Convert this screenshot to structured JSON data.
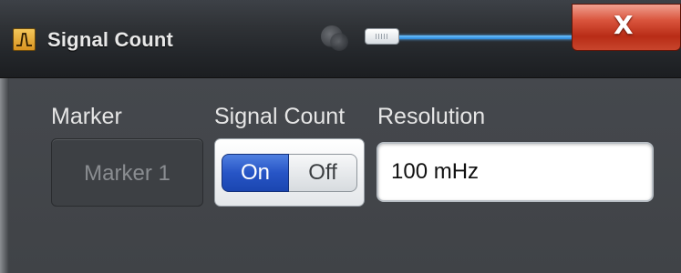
{
  "window": {
    "title": "Signal Count",
    "icon": "waveform-icon",
    "close_label": "X",
    "transparency_level": 0.1
  },
  "fields": {
    "marker_label": "Marker",
    "marker_value": "Marker 1",
    "signal_count_label": "Signal Count",
    "signal_count_on": "On",
    "signal_count_off": "Off",
    "signal_count_state": "On",
    "resolution_label": "Resolution",
    "resolution_value": "100 mHz"
  },
  "colors": {
    "accent_blue": "#2755c6",
    "close_red": "#c8452c",
    "slider_blue": "#2a86d9"
  }
}
